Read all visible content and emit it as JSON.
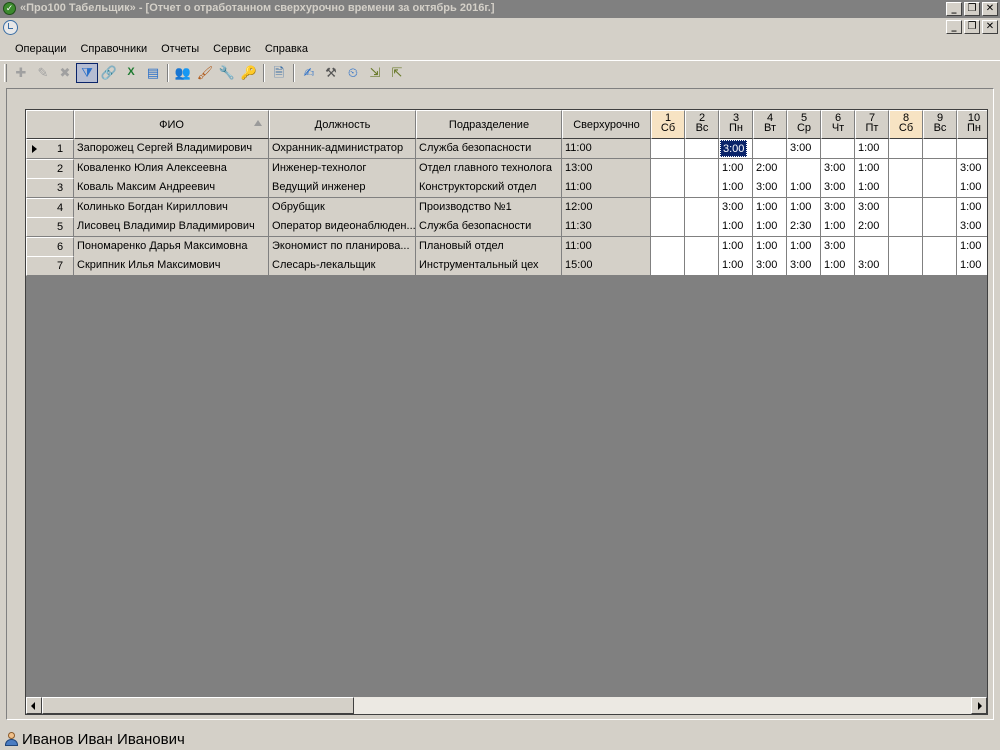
{
  "window": {
    "title": "«Про100 Табельщик» - [Отчет о отработанном сверхурочно времени за октябрь 2016г.]",
    "min_glyph": "_",
    "restore_glyph": "❐",
    "close_glyph": "✕"
  },
  "menu": [
    "Операции",
    "Справочники",
    "Отчеты",
    "Сервис",
    "Справка"
  ],
  "toolbar": {
    "buttons": [
      {
        "icon": "add-icon",
        "glyph": "✚"
      },
      {
        "icon": "edit-icon",
        "glyph": "✎"
      },
      {
        "icon": "delete-icon",
        "glyph": "✖"
      },
      {
        "icon": "filter-icon",
        "glyph": "⧩"
      },
      {
        "icon": "link-icon",
        "glyph": "🔗"
      },
      {
        "icon": "excel-icon",
        "glyph": "X"
      },
      {
        "icon": "report-icon",
        "glyph": "▤"
      },
      {
        "icon": "users-icon",
        "glyph": "👥"
      },
      {
        "icon": "brush-icon",
        "glyph": "🖌"
      },
      {
        "icon": "tools-icon",
        "glyph": "🔧"
      },
      {
        "icon": "key-icon",
        "glyph": "🔑"
      },
      {
        "icon": "document-icon",
        "glyph": "🗎"
      },
      {
        "icon": "pen-icon",
        "glyph": "✍"
      },
      {
        "icon": "hammer-icon",
        "glyph": "⚒"
      },
      {
        "icon": "clock-icon",
        "glyph": "⏲"
      },
      {
        "icon": "import-icon",
        "glyph": "⇲"
      },
      {
        "icon": "export-icon",
        "glyph": "⇱"
      }
    ]
  },
  "table": {
    "headers": {
      "fio": "ФИО",
      "position": "Должность",
      "department": "Подразделение",
      "overtime": "Сверхурочно"
    },
    "days": [
      {
        "num": "1",
        "wd": "Сб",
        "weekend": true
      },
      {
        "num": "2",
        "wd": "Вс",
        "weekend": false
      },
      {
        "num": "3",
        "wd": "Пн",
        "weekend": false
      },
      {
        "num": "4",
        "wd": "Вт",
        "weekend": false
      },
      {
        "num": "5",
        "wd": "Ср",
        "weekend": false
      },
      {
        "num": "6",
        "wd": "Чт",
        "weekend": false
      },
      {
        "num": "7",
        "wd": "Пт",
        "weekend": false
      },
      {
        "num": "8",
        "wd": "Сб",
        "weekend": true
      },
      {
        "num": "9",
        "wd": "Вс",
        "weekend": false
      },
      {
        "num": "10",
        "wd": "Пн",
        "weekend": false
      }
    ],
    "rows": [
      {
        "n": "1",
        "fio": "Запорожец Сергей Владимирович",
        "position": "Охранник-администратор",
        "department": "Служба безопасности",
        "overtime": "11:00",
        "days": [
          "",
          "",
          "3:00",
          "",
          "3:00",
          "",
          "1:00",
          "",
          "",
          ""
        ]
      },
      {
        "n": "2",
        "fio": "Коваленко Юлия Алексеевна",
        "position": "Инженер-технолог",
        "department": "Отдел главного технолога",
        "overtime": "13:00",
        "days": [
          "",
          "",
          "1:00",
          "2:00",
          "",
          "3:00",
          "1:00",
          "",
          "",
          "3:00"
        ]
      },
      {
        "n": "3",
        "fio": "Коваль Максим Андреевич",
        "position": "Ведущий инженер",
        "department": "Конструкторский отдел",
        "overtime": "11:00",
        "days": [
          "",
          "",
          "1:00",
          "3:00",
          "1:00",
          "3:00",
          "1:00",
          "",
          "",
          "1:00"
        ]
      },
      {
        "n": "4",
        "fio": "Колинько Богдан Кириллович",
        "position": "Обрубщик",
        "department": "Производство №1",
        "overtime": "12:00",
        "days": [
          "",
          "",
          "3:00",
          "1:00",
          "1:00",
          "3:00",
          "3:00",
          "",
          "",
          "1:00"
        ]
      },
      {
        "n": "5",
        "fio": "Лисовец Владимир Владимирович",
        "position": "Оператор видеонаблюден...",
        "department": "Служба безопасности",
        "overtime": "11:30",
        "days": [
          "",
          "",
          "1:00",
          "1:00",
          "2:30",
          "1:00",
          "2:00",
          "",
          "",
          "3:00"
        ]
      },
      {
        "n": "6",
        "fio": "Пономаренко Дарья Максимовна",
        "position": "Экономист по планирова...",
        "department": "Плановый отдел",
        "overtime": "11:00",
        "days": [
          "",
          "",
          "1:00",
          "1:00",
          "1:00",
          "3:00",
          "",
          "",
          "",
          "1:00"
        ]
      },
      {
        "n": "7",
        "fio": "Скрипник Илья Максимович",
        "position": "Слесарь-лекальщик",
        "department": "Инструментальный цех",
        "overtime": "15:00",
        "days": [
          "",
          "",
          "1:00",
          "3:00",
          "3:00",
          "1:00",
          "3:00",
          "",
          "",
          "1:00"
        ]
      }
    ],
    "selected": {
      "row": 0,
      "day": 2
    }
  },
  "status": {
    "user": "Иванов Иван Иванович"
  },
  "colors": {
    "weekend_header": "#f7e3c3",
    "selection": "#0a246a",
    "empty_area": "#808080"
  }
}
